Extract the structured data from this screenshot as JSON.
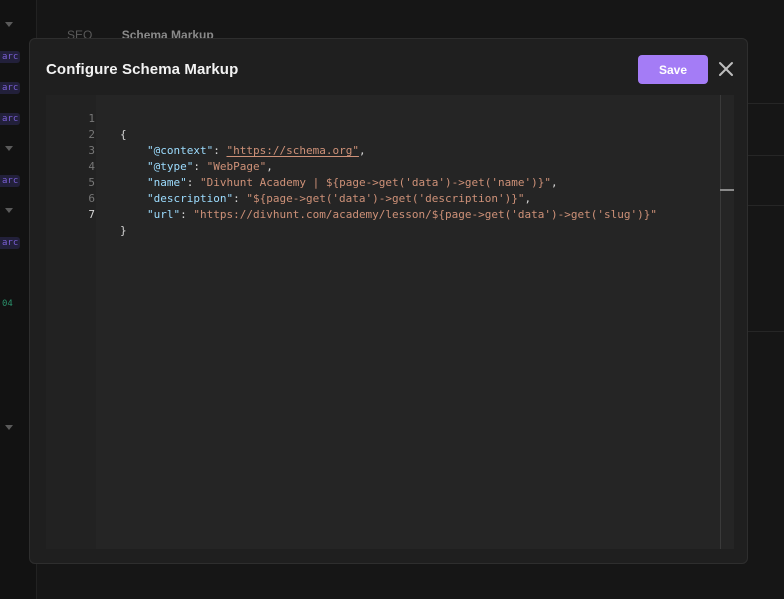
{
  "background": {
    "tabs": [
      "SEO",
      "Schema Markup"
    ],
    "badges": [
      "arc",
      "arc",
      "arc",
      "arc",
      "arc",
      "04"
    ]
  },
  "modal": {
    "title": "Configure Schema Markup",
    "save_label": "Save",
    "accent_color": "#a47cf6"
  },
  "editor": {
    "current_line": 7,
    "lines": [
      {
        "num": "1",
        "text": "{"
      },
      {
        "num": "2",
        "key": "\"@context\"",
        "value": "\"https://schema.org\""
      },
      {
        "num": "3",
        "key": "\"@type\"",
        "value": "\"WebPage\""
      },
      {
        "num": "4",
        "key": "\"name\"",
        "value": "\"Divhunt Academy | ${page->get('data')->get('name')}\""
      },
      {
        "num": "5",
        "key": "\"description\"",
        "value": "\"${page->get('data')->get('description')}\""
      },
      {
        "num": "6",
        "key": "\"url\"",
        "value": "\"https://divhunt.com/academy/lesson/${page->get('data')->get('slug')}\""
      },
      {
        "num": "7",
        "text": "}"
      }
    ]
  }
}
